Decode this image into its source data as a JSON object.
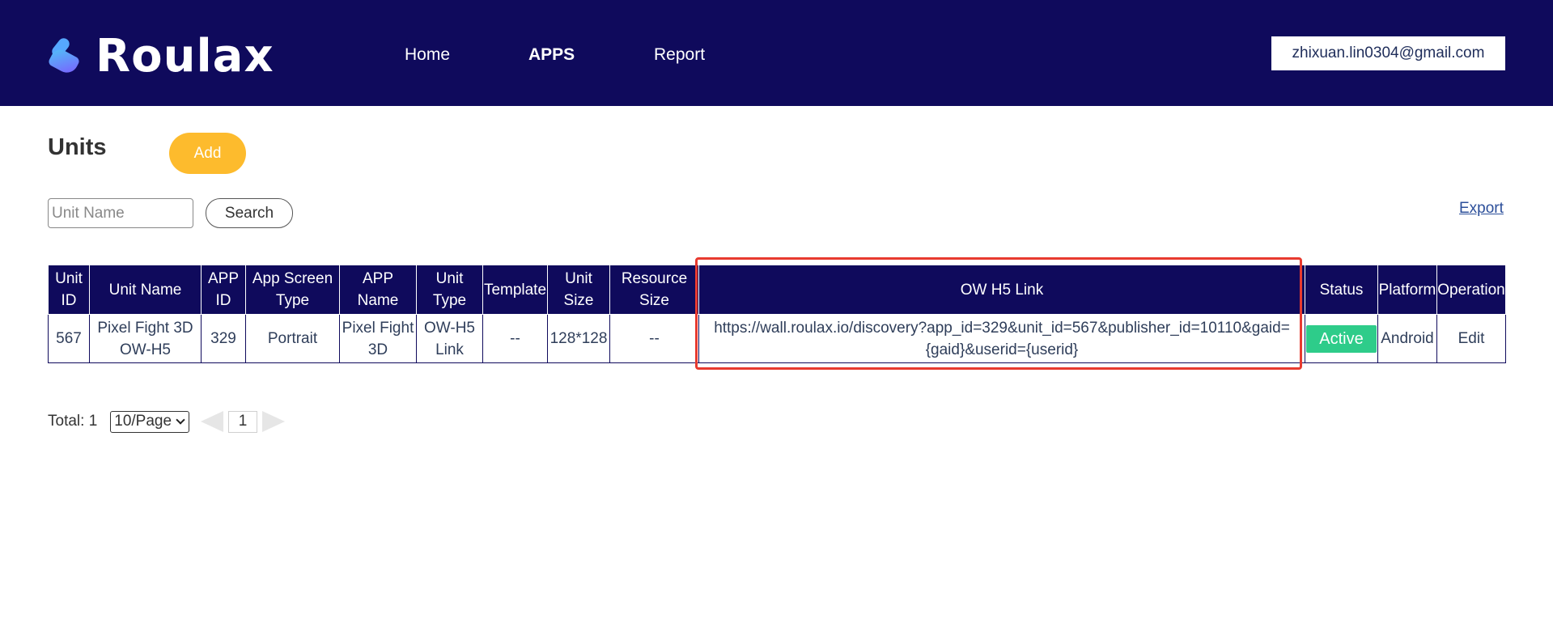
{
  "brand": {
    "name": "Roulax"
  },
  "nav": [
    {
      "label": "Home",
      "active": false
    },
    {
      "label": "APPS",
      "active": true
    },
    {
      "label": "Report",
      "active": false
    }
  ],
  "user": {
    "email": "zhixuan.lin0304@gmail.com"
  },
  "page": {
    "title": "Units",
    "add_label": "Add"
  },
  "search": {
    "placeholder": "Unit Name",
    "value": "",
    "button_label": "Search"
  },
  "export_label": "Export",
  "table": {
    "columns": [
      [
        "Unit",
        "ID"
      ],
      [
        "Unit Name"
      ],
      [
        "APP",
        "ID"
      ],
      [
        "App Screen",
        "Type"
      ],
      [
        "APP",
        "Name"
      ],
      [
        "Unit",
        "Type"
      ],
      [
        "Template"
      ],
      [
        "Unit",
        "Size"
      ],
      [
        "Resource",
        "Size"
      ],
      [
        "OW H5 Link"
      ],
      [
        "Status"
      ],
      [
        "Platform"
      ],
      [
        "Operation"
      ]
    ],
    "rows": [
      {
        "unit_id": "567",
        "unit_name": [
          "Pixel Fight 3D",
          "OW-H5"
        ],
        "app_id": "329",
        "screen_type": "Portrait",
        "app_name": [
          "Pixel Fight",
          "3D"
        ],
        "unit_type": [
          "OW-H5",
          "Link"
        ],
        "template": "--",
        "unit_size": "128*128",
        "resource_size": "--",
        "ow_link": [
          "https://wall.roulax.io/discovery?app_id=329&unit_id=567&publisher_id=10110&gaid=",
          "{gaid}&userid={userid}"
        ],
        "status": "Active",
        "platform": "Android",
        "operation": "Edit"
      }
    ]
  },
  "pagination": {
    "total_label": "Total: 1",
    "page_size": "10/Page",
    "current_page": "1"
  },
  "colors": {
    "header": "#0f0a5c",
    "add_button": "#fdbb2d",
    "status_active": "#2ecc8a",
    "highlight": "#e83a2f"
  }
}
